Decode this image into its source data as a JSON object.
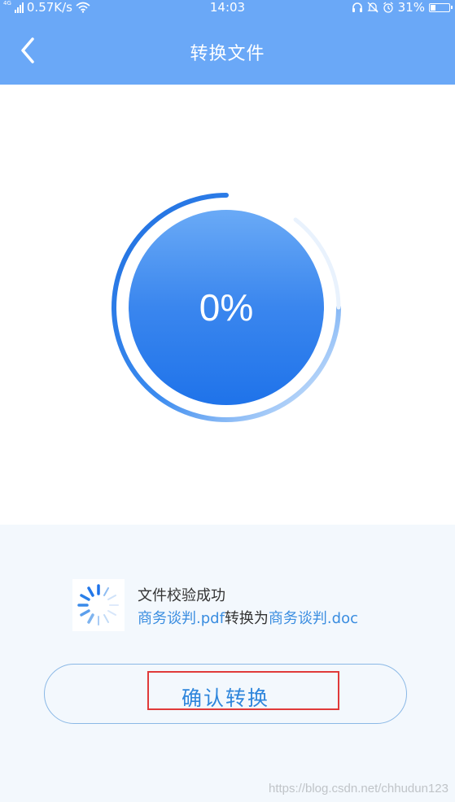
{
  "status_bar": {
    "network_type": "4G",
    "speed": "0.57K/s",
    "time": "14:03",
    "battery": "31%",
    "battery_level": 0.31
  },
  "header": {
    "title": "转换文件"
  },
  "progress": {
    "text": "0%",
    "value": 0
  },
  "status": {
    "title": "文件校验成功",
    "source_file": "商务谈判.pdf",
    "middle_text": "转换为",
    "target_file": "商务谈判.doc"
  },
  "actions": {
    "confirm_label": "确认转换"
  },
  "watermark": "https://blog.csdn.net/chhudun123",
  "colors": {
    "header_bg": "#6aa8f7",
    "accent_blue": "#1f73ea",
    "link_blue": "#3a8de0",
    "highlight_red": "#e03a3a"
  },
  "icons": [
    "chevron-left-icon",
    "wifi-icon",
    "headset-icon",
    "bell-off-icon",
    "alarm-icon",
    "battery-icon",
    "spinner-icon"
  ]
}
